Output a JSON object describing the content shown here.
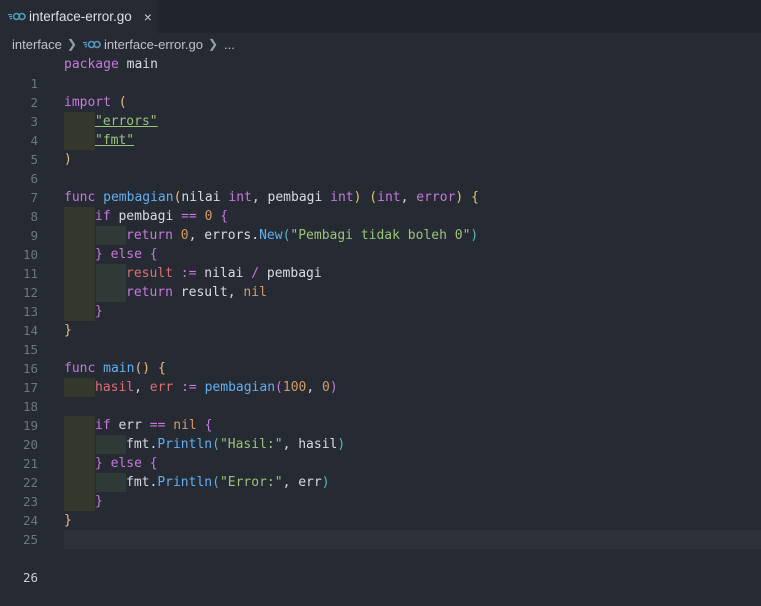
{
  "tab": {
    "title": "interface-error.go",
    "close_glyph": "×",
    "icon": "go-file-icon"
  },
  "breadcrumb": {
    "folder": "interface",
    "file": "interface-error.go",
    "more": "..."
  },
  "editor": {
    "current_line": 26,
    "lines": [
      {
        "n": "1"
      },
      {
        "n": "2"
      },
      {
        "n": "3"
      },
      {
        "n": "4"
      },
      {
        "n": "5"
      },
      {
        "n": "6"
      },
      {
        "n": "7"
      },
      {
        "n": "8"
      },
      {
        "n": "9"
      },
      {
        "n": "10"
      },
      {
        "n": "11"
      },
      {
        "n": "12"
      },
      {
        "n": "13"
      },
      {
        "n": "14"
      },
      {
        "n": "15"
      },
      {
        "n": "16"
      },
      {
        "n": "17"
      },
      {
        "n": "18"
      },
      {
        "n": "19"
      },
      {
        "n": "20"
      },
      {
        "n": "21"
      },
      {
        "n": "22"
      },
      {
        "n": "23"
      },
      {
        "n": "24"
      },
      {
        "n": "25"
      },
      {
        "n": "26"
      }
    ],
    "tokens": {
      "package": "package",
      "main_pkg": "main",
      "import": "import",
      "lparen": "(",
      "rparen": ")",
      "errors_str": "\"errors\"",
      "fmt_str": "\"fmt\"",
      "func": "func",
      "pembagian": "pembagian",
      "nilai": "nilai",
      "int": "int",
      "pembagi": "pembagi",
      "error": "error",
      "if": "if",
      "return": "return",
      "zero": "0",
      "errors_pkg": "errors",
      "New": "New",
      "msg": "\"Pembagi tidak boleh 0\"",
      "else": "else",
      "result": "result",
      "nil": "nil",
      "main_fn": "main",
      "hasil": "hasil",
      "err": "err",
      "hundred": "100",
      "fmt_pkg": "fmt",
      "Println": "Println",
      "hasil_str": "\"Hasil:\"",
      "error_str": "\"Error:\"",
      "assign": ":=",
      "eq": "==",
      "neq": "==",
      "div": "/",
      "lbrace": "{",
      "rbrace": "}",
      "comma": ",",
      "dot": "."
    }
  },
  "colors": {
    "background": "#262a33",
    "tabbar": "#21252b",
    "keyword": "#c678dd",
    "function": "#61afef",
    "string": "#98c379",
    "number": "#d19a66",
    "variable": "#e06c75"
  }
}
